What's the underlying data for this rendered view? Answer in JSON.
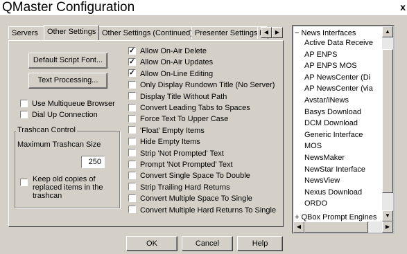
{
  "window": {
    "title": "QMaster Configuration",
    "close_glyph": "x"
  },
  "tabs": [
    {
      "label": "Servers"
    },
    {
      "label": "Other Settings"
    },
    {
      "label": "Other Settings (Continued)"
    },
    {
      "label": "Presenter Settings"
    },
    {
      "label": "Pr"
    }
  ],
  "buttons": {
    "default_script_font": "Default Script Font...",
    "text_processing": "Text Processing...",
    "ok": "OK",
    "cancel": "Cancel",
    "help": "Help"
  },
  "left_options": [
    {
      "label": "Use Multiqueue Browser",
      "checked": false
    },
    {
      "label": "Dial Up Connection",
      "checked": false
    }
  ],
  "trashcan": {
    "legend": "Trashcan Control",
    "max_size_label": "Maximum Trashcan Size",
    "max_size_value": "250",
    "keep_copies_label_1": "Keep old copies of",
    "keep_copies_label_2": "replaced items in the",
    "keep_copies_label_3": "trashcan",
    "keep_copies_checked": false
  },
  "options": [
    {
      "label": "Allow On-Air Delete",
      "checked": true
    },
    {
      "label": "Allow On-Air Updates",
      "checked": true
    },
    {
      "label": "Allow On-Line Editing",
      "checked": true
    },
    {
      "label": "Only Display Rundown Title (No Server)",
      "checked": false
    },
    {
      "label": "Display Title Without Path",
      "checked": false
    },
    {
      "label": "Convert Leading Tabs to Spaces",
      "checked": false
    },
    {
      "label": "Force Text To Upper Case",
      "checked": false
    },
    {
      "label": "'Float' Empty Items",
      "checked": false
    },
    {
      "label": "Hide Empty Items",
      "checked": false
    },
    {
      "label": "Strip 'Not Prompted' Text",
      "checked": false
    },
    {
      "label": "Prompt 'Not Prompted' Text",
      "checked": false
    },
    {
      "label": "Convert Single Space To Double",
      "checked": false
    },
    {
      "label": "Strip Trailing Hard Returns",
      "checked": false
    },
    {
      "label": "Convert Multiple Space To Single",
      "checked": false
    },
    {
      "label": "Convert Multiple Hard Returns To Single",
      "checked": false
    }
  ],
  "tree": {
    "root": {
      "expander": "−",
      "label": "News Interfaces"
    },
    "items": [
      "Active Data Receive",
      "AP ENPS",
      "AP ENPS MOS",
      "AP NewsCenter (Di",
      "AP NewsCenter (via",
      "Avstar/iNews",
      "Basys Download",
      "DCM Download",
      "Generic Interface",
      "MOS",
      "NewsMaker",
      "NewStar Interface",
      "NewsView",
      "Nexus Download",
      "ORDO"
    ],
    "next_root": {
      "expander": "+",
      "label": "QBox Prompt Engines"
    }
  }
}
